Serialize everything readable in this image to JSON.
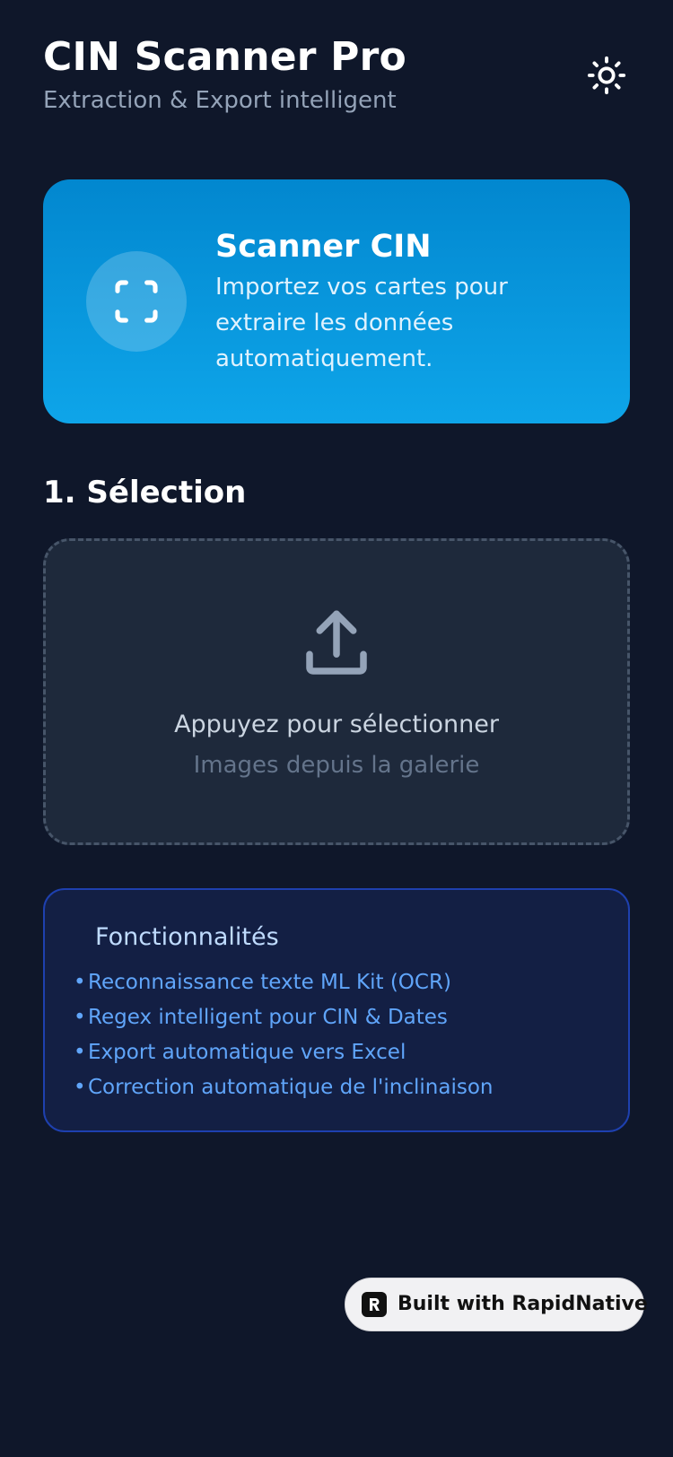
{
  "header": {
    "title": "CIN Scanner Pro",
    "subtitle": "Extraction & Export intelligent",
    "theme_icon": "sun-icon"
  },
  "hero": {
    "icon": "scan-frame-icon",
    "title": "Scanner CIN",
    "description": "Importez vos cartes pour extraire les données automatiquement."
  },
  "selection": {
    "section_title": "1. Sélection",
    "icon": "upload-icon",
    "prompt": "Appuyez pour sélectionner",
    "hint": "Images depuis la galerie"
  },
  "features": {
    "title": "Fonctionnalités",
    "bullet": "•",
    "items": [
      "Reconnaissance texte ML Kit (OCR)",
      "Regex intelligent pour CIN & Dates",
      "Export automatique vers Excel",
      "Correction automatique de l'inclinaison"
    ]
  },
  "badge": {
    "label": "Built with RapidNative",
    "logo_letter": "R"
  },
  "colors": {
    "background": "#0f172a",
    "hero_gradient_top": "#0287cf",
    "hero_gradient_bottom": "#0ea5e9",
    "dropzone_bg": "#1e293b",
    "features_border": "#1e40af",
    "features_text": "#60a5fa"
  }
}
